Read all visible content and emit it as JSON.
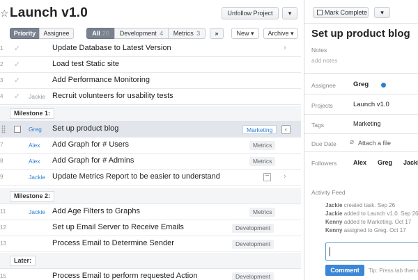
{
  "header": {
    "title": "Launch  v1.0",
    "unfollow_label": "Unfollow Project",
    "caret": "▾"
  },
  "toolbar": {
    "priority": "Priority",
    "assignee": "Assignee",
    "all": "All",
    "all_count": "20",
    "development": "Development",
    "development_count": "4",
    "metrics": "Metrics",
    "metrics_count": "3",
    "more": "»",
    "new": "New ▾",
    "archive": "Archive ▾"
  },
  "tasks": [
    {
      "num": "1",
      "assignee": "",
      "name": "Update Database to Latest Version",
      "tag": ""
    },
    {
      "num": "2",
      "assignee": "",
      "name": "Load test Static site",
      "tag": ""
    },
    {
      "num": "3",
      "assignee": "",
      "name": "Add Performance Monitoring",
      "tag": ""
    },
    {
      "num": "4",
      "assignee": "Jackie",
      "name": "Recruit volunteers for usability tests",
      "tag": ""
    },
    {
      "num": "",
      "assignee": "Greg",
      "name": "Set up product blog",
      "tag": "Marketing"
    },
    {
      "num": "7",
      "assignee": "Alex",
      "name": "Add Graph for # Users",
      "tag": "Metrics"
    },
    {
      "num": "8",
      "assignee": "Alex",
      "name": "Add Graph for # Admins",
      "tag": "Metrics"
    },
    {
      "num": "9",
      "assignee": "Jackie",
      "name": "Update Metrics Report to be easier to understand",
      "tag": ""
    },
    {
      "num": "11",
      "assignee": "Jackie",
      "name": "Add Age Filters to Graphs",
      "tag": "Metrics"
    },
    {
      "num": "12",
      "assignee": "",
      "name": "Set up Email Server to Receive Emails",
      "tag": "Development"
    },
    {
      "num": "13",
      "assignee": "",
      "name": "Process Email to Determine Sender",
      "tag": "Development"
    },
    {
      "num": "15",
      "assignee": "",
      "name": "Process Email to perform requested Action",
      "tag": "Development"
    }
  ],
  "milestones": [
    "Milestone 1:",
    "Milestone 2:",
    "Later:"
  ],
  "detail": {
    "mark_complete": "Mark Complete",
    "caret": "▾",
    "title": "Set up product blog",
    "notes_label": "Notes",
    "notes_placeholder": "add notes",
    "assignee_label": "Assignee",
    "assignee_value": "Greg",
    "projects_label": "Projects",
    "projects_value": "Launch v1.0",
    "tags_label": "Tags",
    "tags_value": "Marketing",
    "due_label": "Due Date",
    "attach_label": "Attach a file",
    "followers_label": "Followers",
    "followers": [
      "Alex",
      "Greg",
      "Jackie"
    ],
    "activity_label": "Activity Feed",
    "activity": [
      {
        "who": "Jackie",
        "text": "created task.",
        "when": "Sep 26"
      },
      {
        "who": "Jackie",
        "text": "added to Launch  v1.0.",
        "when": "Sep 26"
      },
      {
        "who": "Kenny",
        "text": "added to Marketing.",
        "when": "Oct 17"
      },
      {
        "who": "Kenny",
        "text": "assigned to Greg.",
        "when": "Oct 17"
      }
    ],
    "comment_button": "Comment",
    "tip": "Tip: Press tab then enter"
  },
  "colors": {
    "accent": "#3b86d6",
    "assignee_link": "#2c7fd0",
    "selected_row": "#e2e6ec"
  }
}
